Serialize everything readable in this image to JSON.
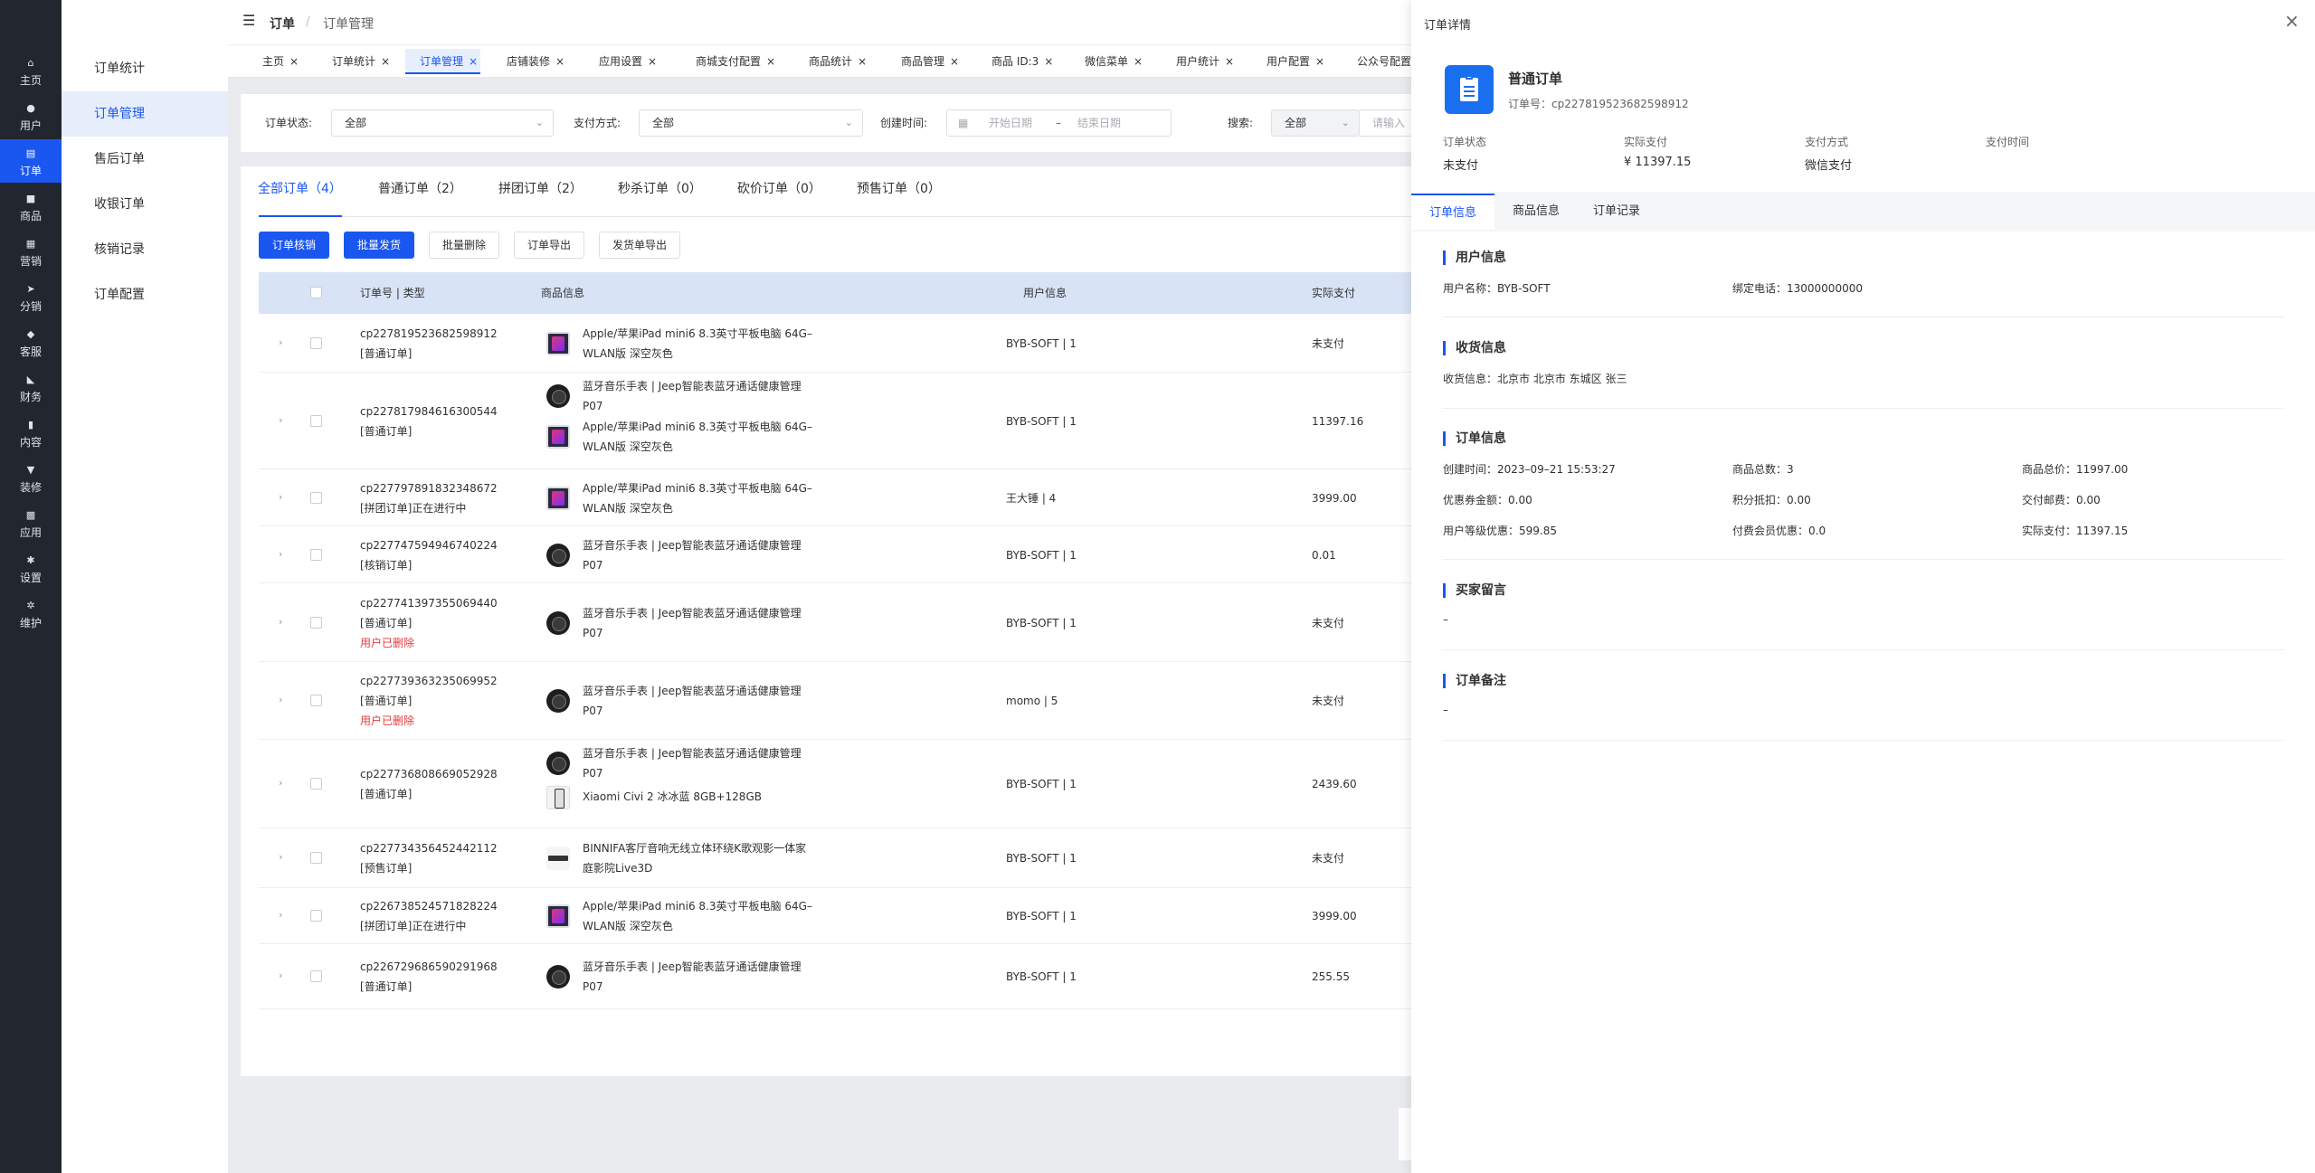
{
  "rail": [
    {
      "icon": "home-icon",
      "glyph": "⌂",
      "label": "主页"
    },
    {
      "icon": "user-icon",
      "glyph": "●",
      "label": "用户"
    },
    {
      "icon": "order-icon",
      "glyph": "▤",
      "label": "订单"
    },
    {
      "icon": "goods-icon",
      "glyph": "■",
      "label": "商品"
    },
    {
      "icon": "marketing-icon",
      "glyph": "▦",
      "label": "营销"
    },
    {
      "icon": "share-icon",
      "glyph": "➤",
      "label": "分销"
    },
    {
      "icon": "service-icon",
      "glyph": "◆",
      "label": "客服"
    },
    {
      "icon": "finance-icon",
      "glyph": "◣",
      "label": "财务"
    },
    {
      "icon": "content-icon",
      "glyph": "▮",
      "label": "内容"
    },
    {
      "icon": "decorate-icon",
      "glyph": "▼",
      "label": "装修"
    },
    {
      "icon": "apps-icon",
      "glyph": "▩",
      "label": "应用"
    },
    {
      "icon": "settings-icon",
      "glyph": "✱",
      "label": "设置"
    },
    {
      "icon": "maintain-icon",
      "glyph": "✲",
      "label": "维护"
    }
  ],
  "submenu": [
    "订单统计",
    "订单管理",
    "售后订单",
    "收银订单",
    "核销记录",
    "订单配置"
  ],
  "header": {
    "menu_icon": "☰",
    "crumb_root": "订单",
    "crumb_sep": "/",
    "crumb_current": "订单管理"
  },
  "tabs": [
    "主页",
    "订单统计",
    "订单管理",
    "店铺装修",
    "应用设置",
    "商城支付配置",
    "商品统计",
    "商品管理",
    "商品 ID:3",
    "微信菜单",
    "用户统计",
    "用户配置",
    "公众号配置"
  ],
  "tab_close": "×",
  "filter": {
    "status_label": "订单状态:",
    "status_value": "全部",
    "pay_label": "支付方式:",
    "pay_value": "全部",
    "created_label": "创建时间:",
    "date_start": "开始日期",
    "date_sep": "–",
    "date_end": "结束日期",
    "search_label": "搜索:",
    "search_scope": "全部",
    "search_placeholder": "请输入"
  },
  "order_tabs": [
    "全部订单（4）",
    "普通订单（2）",
    "拼团订单（2）",
    "秒杀订单（0）",
    "砍价订单（0）",
    "预售订单（0）"
  ],
  "actions": [
    "订单核销",
    "批量发货",
    "批量删除",
    "订单导出",
    "发货单导出"
  ],
  "table": {
    "headers": [
      "订单号 | 类型",
      "商品信息",
      "用户信息",
      "实际支付"
    ],
    "rows": [
      {
        "no": "cp227819523682598912",
        "type": "[普通订单]",
        "warn": "",
        "goods": [
          {
            "img": "ipad",
            "l1": "Apple/苹果iPad mini6 8.3英寸平板电脑 64G–",
            "l2": "WLAN版 深空灰色"
          }
        ],
        "user": "BYB-SOFT | 1",
        "pay": "未支付"
      },
      {
        "no": "cp227817984616300544",
        "type": "[普通订单]",
        "warn": "",
        "goods": [
          {
            "img": "watch",
            "l1": "蓝牙音乐手表 | Jeep智能表蓝牙通话健康管理",
            "l2": "P07"
          },
          {
            "img": "ipad",
            "l1": "Apple/苹果iPad mini6 8.3英寸平板电脑 64G–",
            "l2": "WLAN版 深空灰色"
          }
        ],
        "user": "BYB-SOFT | 1",
        "pay": "11397.16"
      },
      {
        "no": "cp227797891832348672",
        "type": "[拼团订单]正在进行中",
        "warn": "",
        "goods": [
          {
            "img": "ipad",
            "l1": "Apple/苹果iPad mini6 8.3英寸平板电脑 64G–",
            "l2": "WLAN版 深空灰色"
          }
        ],
        "user": "王大锤 | 4",
        "pay": "3999.00"
      },
      {
        "no": "cp227747594946740224",
        "type": "[核销订单]",
        "warn": "",
        "goods": [
          {
            "img": "watch",
            "l1": "蓝牙音乐手表 | Jeep智能表蓝牙通话健康管理",
            "l2": "P07"
          }
        ],
        "user": "BYB-SOFT | 1",
        "pay": "0.01"
      },
      {
        "no": "cp227741397355069440",
        "type": "[普通订单]",
        "warn": "用户已删除",
        "goods": [
          {
            "img": "watch",
            "l1": "蓝牙音乐手表 | Jeep智能表蓝牙通话健康管理",
            "l2": "P07"
          }
        ],
        "user": "BYB-SOFT | 1",
        "pay": "未支付"
      },
      {
        "no": "cp227739363235069952",
        "type": "[普通订单]",
        "warn": "用户已删除",
        "goods": [
          {
            "img": "watch",
            "l1": "蓝牙音乐手表 | Jeep智能表蓝牙通话健康管理",
            "l2": "P07"
          }
        ],
        "user": "momo | 5",
        "pay": "未支付"
      },
      {
        "no": "cp227736808669052928",
        "type": "[普通订单]",
        "warn": "",
        "goods": [
          {
            "img": "watch",
            "l1": "蓝牙音乐手表 | Jeep智能表蓝牙通话健康管理",
            "l2": "P07"
          },
          {
            "img": "phone",
            "l1": "Xiaomi Civi 2 冰冰蓝 8GB+128GB",
            "l2": ""
          }
        ],
        "user": "BYB-SOFT | 1",
        "pay": "2439.60"
      },
      {
        "no": "cp227734356452442112",
        "type": "[预售订单]",
        "warn": "",
        "goods": [
          {
            "img": "speaker",
            "l1": "BINNIFA客厅音响无线立体环绕K歌观影一体家",
            "l2": "庭影院Live3D"
          }
        ],
        "user": "BYB-SOFT | 1",
        "pay": "未支付"
      },
      {
        "no": "cp226738524571828224",
        "type": "[拼团订单]正在进行中",
        "warn": "",
        "goods": [
          {
            "img": "ipad",
            "l1": "Apple/苹果iPad mini6 8.3英寸平板电脑 64G–",
            "l2": "WLAN版 深空灰色"
          }
        ],
        "user": "BYB-SOFT | 1",
        "pay": "3999.00"
      },
      {
        "no": "cp226729686590291968",
        "type": "[普通订单]",
        "warn": "",
        "goods": [
          {
            "img": "watch",
            "l1": "蓝牙音乐手表 | Jeep智能表蓝牙通话健康管理",
            "l2": "P07"
          }
        ],
        "user": "BYB-SOFT | 1",
        "pay": "255.55"
      }
    ]
  },
  "drawer": {
    "title": "订单详情",
    "close": "×",
    "order_type": "普通订单",
    "order_no": "订单号：cp227819523682598912",
    "summary": [
      {
        "label": "订单状态",
        "value": "未支付"
      },
      {
        "label": "实际支付",
        "value": "¥ 11397.15"
      },
      {
        "label": "支付方式",
        "value": "微信支付"
      },
      {
        "label": "支付时间",
        "value": ""
      }
    ],
    "tabs": [
      "订单信息",
      "商品信息",
      "订单记录"
    ],
    "sections": {
      "user": {
        "title": "用户信息",
        "items": [
          "用户名称：BYB-SOFT",
          "绑定电话：13000000000"
        ]
      },
      "shipping": {
        "title": "收货信息",
        "items": [
          "收货信息：北京市 北京市 东城区 张三"
        ]
      },
      "order": {
        "title": "订单信息",
        "items": [
          "创建时间：2023–09–21 15:53:27",
          "商品总数：3",
          "商品总价：11997.00",
          "优惠券金额：0.00",
          "积分抵扣：0.00",
          "交付邮费：0.00",
          "用户等级优惠：599.85",
          "付费会员优惠：0.0",
          "实际支付：11397.15"
        ]
      },
      "message": {
        "title": "买家留言",
        "value": "–"
      },
      "remark": {
        "title": "订单备注",
        "value": "–"
      }
    }
  }
}
